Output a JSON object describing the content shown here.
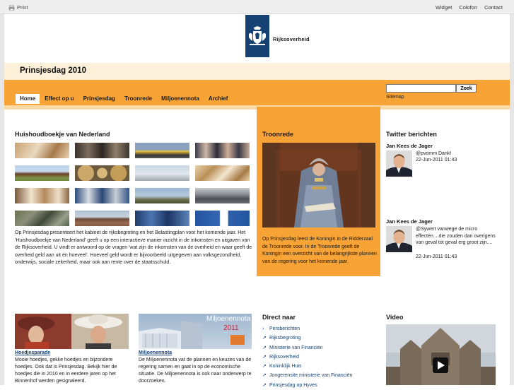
{
  "topbar": {
    "print_label": "Print",
    "links": [
      "Widget",
      "Colofon",
      "Contact"
    ]
  },
  "header": {
    "logo_text": "Rijksoverheid",
    "site_title": "Prinsjesdag 2010"
  },
  "nav": {
    "items": [
      "Home",
      "Effect op u",
      "Prinsjesdag",
      "Troonrede",
      "Miljoenennota",
      "Archief"
    ],
    "active": "Home"
  },
  "search": {
    "value": "",
    "button_label": "Zoek",
    "sitemap_label": "Sitemap"
  },
  "huishoudboekje": {
    "title": "Huishoudboekje van Nederland",
    "text": "Op Prinsjesdag presenteert het kabinet de rijksbegroting en het Belastingplan voor het komende jaar. Het 'Huishoudboekje van Nederland' geeft u op een interactieve manier inzicht in de inkomsten en uitgaven van de Rijksoverheid. U vindt er antwoord op de vragen 'wat zijn de inkomsten van de overheid en waar geeft de overheid geld aan uit én hoeveel'. Hoeveel geld wordt er bijvoorbeeld uitgegeven aan volksgezondheid, onderwijs, sociale zekerheid, maar ook aan rente over de staatsschuld."
  },
  "troonrede": {
    "title": "Troonrede",
    "text": "Op Prinsjesdag leest de Koningin in de Ridderzaal de Troonrede voor. In de Troonrede geeft de Koningin een overzicht van de belangrijkste plannen van de regering voor het komende jaar."
  },
  "twitter": {
    "title": "Twitter berichten",
    "tweets": [
      {
        "user": "Jan Kees de Jager",
        "message": "@pvomm Dank!",
        "time": "22-Jun-2011 01:43"
      },
      {
        "user": "Jan Kees de Jager",
        "message": "@Sywert vanwege de micro effecten....die zouden dan overigens van geval tot geval erg groot zijn....",
        "time": "22-Jun-2011 01:43"
      }
    ]
  },
  "hoedjes": {
    "link": "Hoedjesparade",
    "text": "Mooie hoedjes, gekke hoedjes en bijzondere hoedjes. Ook dat is Prinsjesdag. Bekijk hier de hoedjes die in 2010 en in eerdere jaren op het Binnenhof werden gesignaleerd."
  },
  "miljoenennota": {
    "image_caption": "Miljoenennota",
    "image_year": "2011",
    "link": "Miljoenennota",
    "text": "De Miljoenennota vat de plannen en keuzes van de regering samen en gaat in op de economische situatie. De Miljoenennota is ook naar onderwerp te doorzoeken."
  },
  "direct_naar": {
    "title": "Direct naar",
    "items": [
      {
        "label": "Persberichten",
        "icon": "chevron-right-icon"
      },
      {
        "label": "Rijksbegroting",
        "icon": "external-link-icon"
      },
      {
        "label": "Ministerie van Financiën",
        "icon": "external-link-icon"
      },
      {
        "label": "Rijksoverheid",
        "icon": "external-link-icon"
      },
      {
        "label": "Koninklijk Huis",
        "icon": "external-link-icon"
      },
      {
        "label": "Jongerensite ministerie van Financiën",
        "icon": "external-link-icon"
      },
      {
        "label": "Prinsjesdag op Hyves",
        "icon": "external-link-icon"
      }
    ]
  },
  "video": {
    "title": "Video"
  },
  "colors": {
    "orange": "#f7a336",
    "light_orange": "#fdf0d9",
    "logo_blue": "#154273"
  }
}
